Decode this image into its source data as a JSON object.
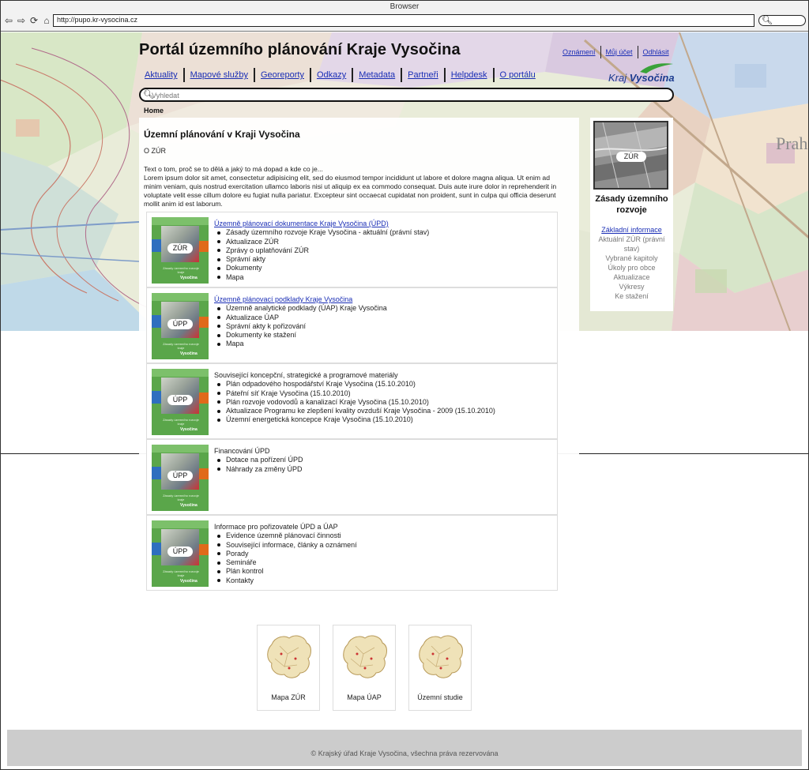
{
  "browser": {
    "title": "Browser",
    "url": "http://pupo.kr-vysocina.cz"
  },
  "header": {
    "site_title": "Portál územního plánování Kraje Vysočina",
    "top_links": [
      "Oznámení",
      "Můj účet",
      "Odhlásit"
    ],
    "nav": [
      "Aktuality",
      "Mapové služby",
      "Georeporty",
      "Odkazy",
      "Metadata",
      "Partneři",
      "Helpdesk",
      "O portálu"
    ],
    "logo_kraj": "Kraj",
    "logo_name": "Vysočina",
    "search_placeholder": "Vyhledat"
  },
  "breadcrumb": "Home",
  "main": {
    "title": "Územní plánování v Kraji Vysočina",
    "subtitle": "O ZÚR",
    "intro": "Text o tom, proč se to dělá a jaký to má dopad a kde co je...\nLorem ipsum dolor sit amet, consectetur adipisicing elit, sed do eiusmod tempor incididunt ut labore et dolore magna aliqua. Ut enim ad minim veniam, quis nostrud exercitation ullamco laboris nisi ut aliquip ex ea commodo consequat. Duis aute irure dolor in reprehenderit in voluptate velit esse cillum dolore eu fugiat nulla pariatur. Excepteur sint occaecat cupidatat non proident, sunt in culpa qui officia deserunt mollit anim id est laborum.",
    "sections": [
      {
        "badge": "ZÚR",
        "heading": "Územně plánovací dokumentace Kraje Vysočina (ÚPD)",
        "link": true,
        "items": [
          "Zásady územního rozvoje Kraje Vysočina - aktuální (právní stav)",
          "Aktualizace ZÚR",
          "Zprávy o uplatňování ZÚR",
          "Správní akty",
          "Dokumenty",
          "Mapa"
        ]
      },
      {
        "badge": "ÚPP",
        "heading": "Územně plánovací podklady Kraje Vysočina",
        "link": true,
        "items": [
          "Územně analytické podklady (ÚAP) Kraje Vysočina",
          "Aktualizace ÚAP",
          "Správní akty k pořizování",
          "Dokumenty ke stažení",
          "Mapa"
        ]
      },
      {
        "badge": "ÚPP",
        "heading": "Související koncepční, strategické a programové materiály",
        "link": false,
        "items": [
          "Plán odpadového hospodářství Kraje Vysočina (15.10.2010)",
          "Páteřní síť Kraje Vysočina (15.10.2010)",
          "Plán rozvoje vodovodů a kanalizací Kraje Vysočina (15.10.2010)",
          "Aktualizace Programu ke zlepšení kvality ovzduší Kraje Vysočina - 2009 (15.10.2010)",
          "Územní energetická koncepce Kraje Vysočina (15.10.2010)"
        ]
      },
      {
        "badge": "ÚPP",
        "heading": "Financování ÚPD",
        "link": false,
        "items": [
          "Dotace na pořízení ÚPD",
          "Náhrady za změny ÚPD"
        ]
      },
      {
        "badge": "ÚPP",
        "heading": "Informace pro pořizovatele ÚPD a ÚAP",
        "link": false,
        "items": [
          "Evidence územně plánovací činnosti",
          "Související informace, články a oznámení",
          "Porady",
          "Semináře",
          "Plán kontrol",
          "Kontakty"
        ]
      }
    ],
    "thumb_caption": "Zásady územního rozvoje kraje",
    "thumb_brand": "Vysočina",
    "maps": [
      "Mapa ZÚR",
      "Mapa ÚAP",
      "Územní studie"
    ]
  },
  "sidebar": {
    "badge": "ZÚR",
    "title": "Zásady územního rozvoje",
    "links": [
      "Základní informace",
      "Aktuální ZÚR (právní stav)",
      "Vybrané kapitoly",
      "Úkoly pro obce",
      "Aktualizace",
      "Výkresy",
      "Ke stažení"
    ]
  },
  "footer": {
    "text": "Krajský úřad Kraje Vysočina, všechna práva rezervována"
  },
  "colors": {
    "link": "#1a2eb5",
    "thumb_green": "#5aa64a",
    "footer_bg": "#cccccc"
  }
}
